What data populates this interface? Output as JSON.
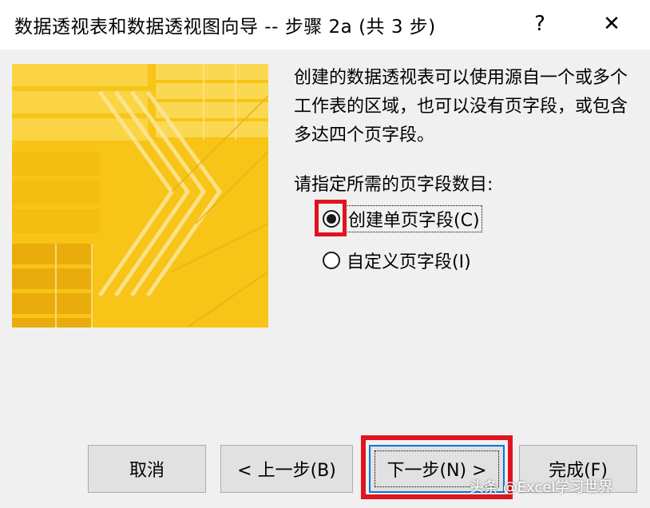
{
  "window": {
    "title": "数据透视表和数据透视图向导 -- 步骤 2a (共 3 步)",
    "help_label": "?",
    "close_label": "✕"
  },
  "content": {
    "description": "创建的数据透视表可以使用源自一个或多个工作表的区域，也可以没有页字段，或包含多达四个页字段。",
    "prompt": "请指定所需的页字段数目:",
    "options": [
      {
        "label": "创建单页字段(C)",
        "selected": true
      },
      {
        "label": "自定义页字段(I)",
        "selected": false
      }
    ]
  },
  "buttons": {
    "cancel": "取消",
    "back": "< 上一步(B)",
    "next": "下一步(N) >",
    "finish": "完成(F)"
  },
  "watermark": "头条 @Excel学习世界",
  "colors": {
    "banner_yellow": "#f7c417",
    "highlight_red": "#e0141f",
    "focus_blue": "#0078d7"
  }
}
